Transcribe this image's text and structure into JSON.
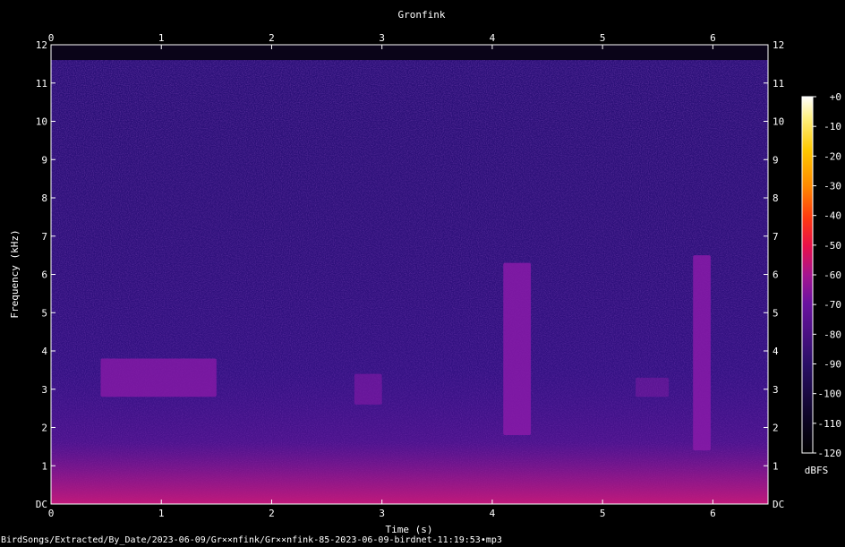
{
  "chart_data": {
    "type": "heatmap",
    "title": "Gronfink",
    "xlabel": "Time (s)",
    "ylabel": "Frequency (kHz)",
    "xlim": [
      0,
      6.5
    ],
    "ylim": [
      0,
      12
    ],
    "x_ticks": [
      "0",
      "1",
      "2",
      "3",
      "4",
      "5",
      "6"
    ],
    "y_ticks": [
      "DC",
      "1",
      "2",
      "3",
      "4",
      "5",
      "6",
      "7",
      "8",
      "9",
      "10",
      "11",
      "12"
    ],
    "colorbar": {
      "label": "dBFS",
      "ticks": [
        "+0",
        "-10",
        "-20",
        "-30",
        "-40",
        "-50",
        "-60",
        "-70",
        "-80",
        "-90",
        "-100",
        "-110",
        "-120"
      ],
      "range": [
        -120,
        0
      ]
    },
    "background_level_dbfs": -100,
    "noise_floor_top_khz": 11.6,
    "events": [
      {
        "t_start": 0.45,
        "t_end": 1.5,
        "f_low": 2.8,
        "f_high": 3.8,
        "level_dbfs": -75
      },
      {
        "t_start": 2.75,
        "t_end": 3.0,
        "f_low": 2.6,
        "f_high": 3.4,
        "level_dbfs": -85
      },
      {
        "t_start": 4.1,
        "t_end": 4.35,
        "f_low": 1.8,
        "f_high": 6.3,
        "level_dbfs": -72
      },
      {
        "t_start": 5.3,
        "t_end": 5.6,
        "f_low": 2.8,
        "f_high": 3.3,
        "level_dbfs": -90
      },
      {
        "t_start": 5.82,
        "t_end": 5.98,
        "f_low": 1.4,
        "f_high": 6.5,
        "level_dbfs": -72
      }
    ]
  },
  "footer_text": "BirdSongs/Extracted/By_Date/2023-06-09/Gr××nfink/Gr××nfink-85-2023-06-09-birdnet-11:19:53∙mp3"
}
